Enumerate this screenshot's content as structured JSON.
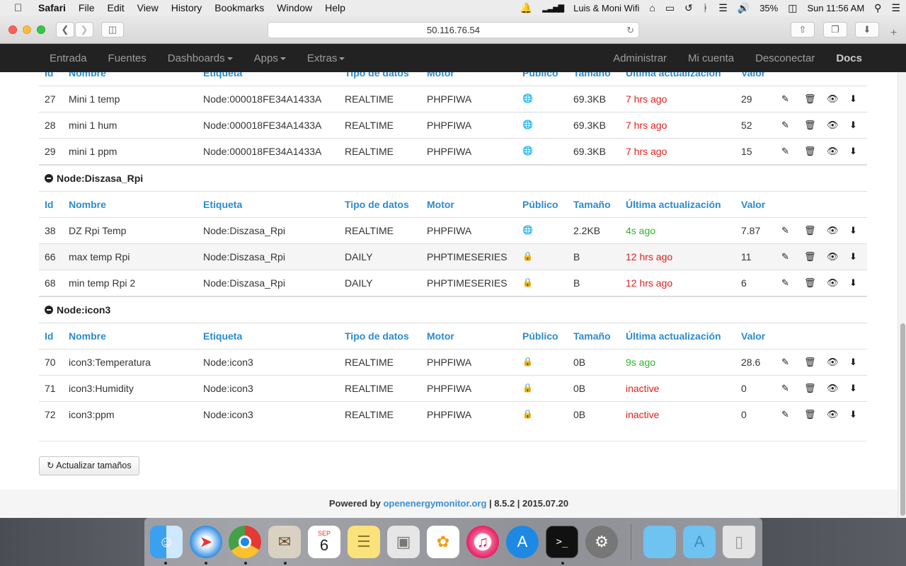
{
  "menubar": {
    "app": "Safari",
    "items": [
      "File",
      "Edit",
      "View",
      "History",
      "Bookmarks",
      "Window",
      "Help"
    ],
    "wifi_name": "Luis & Moni  Wifi",
    "battery": "35%",
    "clock": "Sun 11:56 AM"
  },
  "browser": {
    "url": "50.116.76.54"
  },
  "nav": {
    "left": [
      "Entrada",
      "Fuentes",
      "Dashboards",
      "Apps",
      "Extras"
    ],
    "right": [
      "Administrar",
      "Mi cuenta",
      "Desconectar",
      "Docs"
    ]
  },
  "table": {
    "headers": [
      "Id",
      "Nombre",
      "Etiqueta",
      "Tipo de datos",
      "Motor",
      "Público",
      "Tamaño",
      "Última actualización",
      "Valor"
    ],
    "groups": [
      {
        "node": "",
        "rows": [
          {
            "id": "27",
            "name": "Mini 1 temp",
            "tag": "Node:000018FE34A1433A",
            "type": "REALTIME",
            "engine": "PHPFIWA",
            "public": "globe-icon",
            "size": "69.3KB",
            "updated": "7 hrs ago",
            "status": "red",
            "value": "29"
          },
          {
            "id": "28",
            "name": "mini 1 hum",
            "tag": "Node:000018FE34A1433A",
            "type": "REALTIME",
            "engine": "PHPFIWA",
            "public": "globe-icon",
            "size": "69.3KB",
            "updated": "7 hrs ago",
            "status": "red",
            "value": "52"
          },
          {
            "id": "29",
            "name": "mini 1 ppm",
            "tag": "Node:000018FE34A1433A",
            "type": "REALTIME",
            "engine": "PHPFIWA",
            "public": "globe-icon",
            "size": "69.3KB",
            "updated": "7 hrs ago",
            "status": "red",
            "value": "15"
          }
        ]
      },
      {
        "node": "Node:Diszasa_Rpi",
        "rows": [
          {
            "id": "38",
            "name": "DZ Rpi Temp",
            "tag": "Node:Diszasa_Rpi",
            "type": "REALTIME",
            "engine": "PHPFIWA",
            "public": "globe-icon",
            "size": "2.2KB",
            "updated": "4s ago",
            "status": "green",
            "value": "7.87"
          },
          {
            "id": "66",
            "name": "max temp Rpi",
            "tag": "Node:Diszasa_Rpi",
            "type": "DAILY",
            "engine": "PHPTIMESERIES",
            "public": "lock-icon",
            "size": "B",
            "updated": "12 hrs ago",
            "status": "red",
            "value": "11"
          },
          {
            "id": "68",
            "name": "min temp Rpi 2",
            "tag": "Node:Diszasa_Rpi",
            "type": "DAILY",
            "engine": "PHPTIMESERIES",
            "public": "lock-icon",
            "size": "B",
            "updated": "12 hrs ago",
            "status": "red",
            "value": "6"
          }
        ]
      },
      {
        "node": "Node:icon3",
        "rows": [
          {
            "id": "70",
            "name": "icon3:Temperatura",
            "tag": "Node:icon3",
            "type": "REALTIME",
            "engine": "PHPFIWA",
            "public": "lock-icon",
            "size": "0B",
            "updated": "9s ago",
            "status": "green",
            "value": "28.6"
          },
          {
            "id": "71",
            "name": "icon3:Humidity",
            "tag": "Node:icon3",
            "type": "REALTIME",
            "engine": "PHPFIWA",
            "public": "lock-icon",
            "size": "0B",
            "updated": "inactive",
            "status": "red",
            "value": "0"
          },
          {
            "id": "72",
            "name": "icon3:ppm",
            "tag": "Node:icon3",
            "type": "REALTIME",
            "engine": "PHPFIWA",
            "public": "lock-icon",
            "size": "0B",
            "updated": "inactive",
            "status": "red",
            "value": "0"
          }
        ]
      }
    ]
  },
  "update_button": "Actualizar tamaños",
  "footer": {
    "powered": "Powered by",
    "link": "openenergymonitor.org",
    "version": "| 8.5.2 | 2015.07.20"
  },
  "calendar_month": "SEP",
  "calendar_day": "6",
  "colors": {
    "link_blue": "#2a8bd0",
    "red": "#e0201d",
    "green": "#2fb42f",
    "navbar": "#222222"
  }
}
